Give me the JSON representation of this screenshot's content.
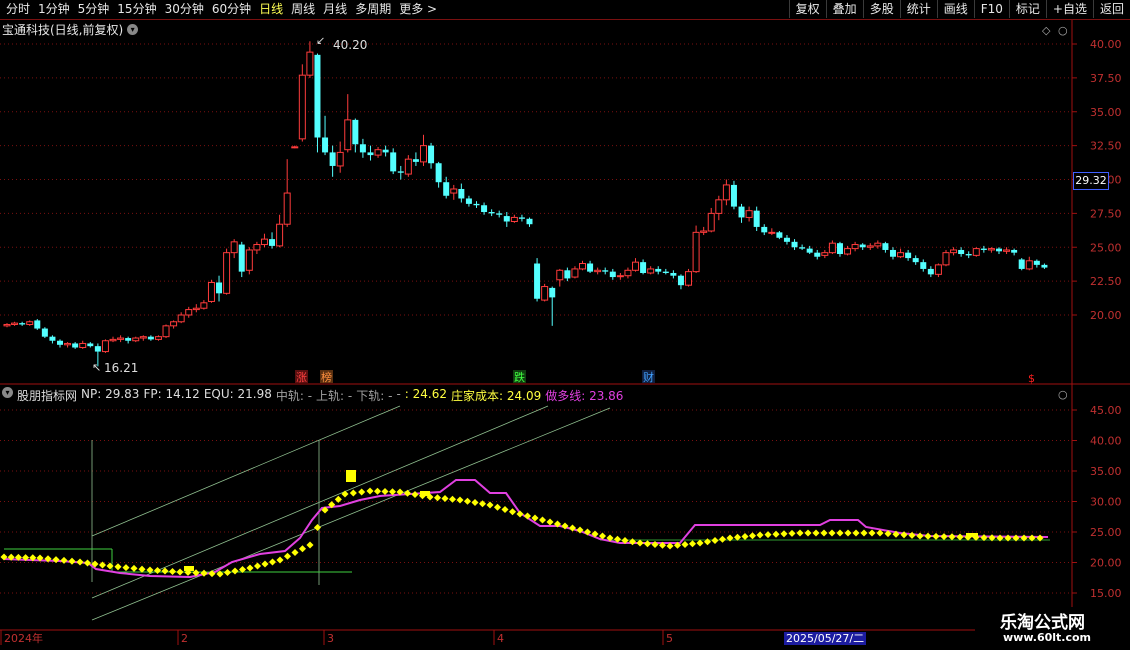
{
  "toolbar": {
    "periods": [
      "分时",
      "1分钟",
      "5分钟",
      "15分钟",
      "30分钟",
      "60分钟",
      "日线",
      "周线",
      "月线",
      "多周期",
      "更多 >"
    ],
    "active_period": "日线",
    "buttons": [
      "复权",
      "叠加",
      "多股",
      "统计",
      "画线",
      "F10",
      "标记",
      "+自选",
      "返回"
    ]
  },
  "main_chart": {
    "title": "宝通科技(日线,前复权)",
    "high_label": "40.20",
    "low_label": "16.21",
    "current_price": "29.32",
    "y_ticks": [
      "40.00",
      "37.50",
      "35.00",
      "32.50",
      "30.00",
      "27.50",
      "25.00",
      "22.50",
      "20.00"
    ],
    "markers": [
      {
        "text": "涨",
        "color": "#ff4040"
      },
      {
        "text": "榜",
        "color": "#ff8040"
      },
      {
        "text": "跌",
        "color": "#40ff40"
      },
      {
        "text": "财",
        "color": "#40a0ff"
      },
      {
        "text": "$",
        "color": "#ff2020"
      }
    ]
  },
  "indicator": {
    "name": "股朋指标网",
    "np": "NP: 29.83",
    "fp": "FP: 14.12",
    "equ": "EQU: 21.98",
    "mid": "中轨: -",
    "upper": "上轨: -",
    "lower": "下轨: -",
    "unknown": ": 24.62",
    "cost": "庄家成本: 24.09",
    "bull": "做多线: 23.86",
    "y_ticks": [
      "45.00",
      "40.00",
      "35.00",
      "30.00",
      "25.00",
      "20.00",
      "15.00"
    ]
  },
  "x_axis": {
    "labels": [
      "2024年",
      "2",
      "3",
      "4",
      "5"
    ],
    "cursor_date": "2025/05/27/二"
  },
  "watermark": {
    "line1": "乐淘公式网",
    "line2": "www.60lt.com"
  },
  "colors": {
    "up": "#ff3c3c",
    "down": "#54ffff",
    "yellow": "#ffff00",
    "magenta": "#e040e0",
    "grid": "#8b0000"
  }
}
